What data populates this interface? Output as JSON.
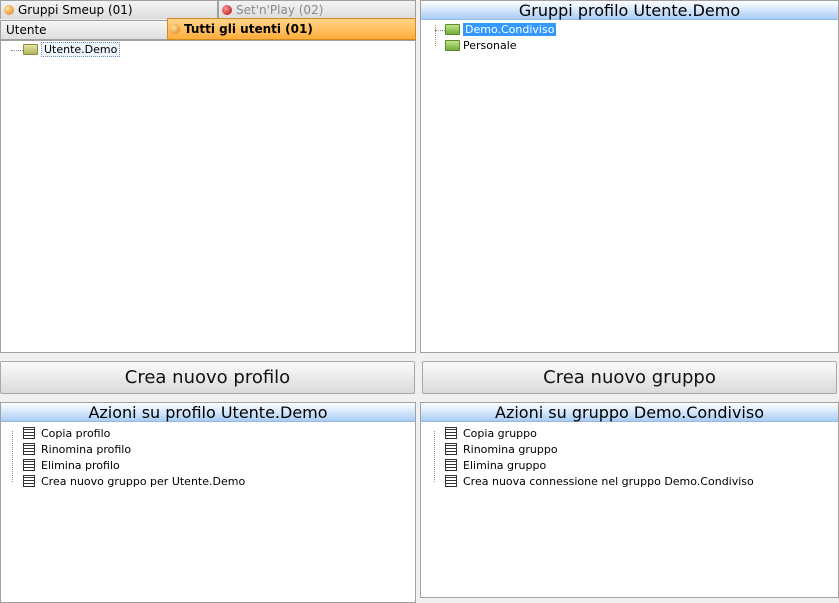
{
  "tabs": {
    "gruppi_smeup": "Gruppi Smeup (01)",
    "setnplay": "Set'n'Play (02)",
    "utente": "Utente",
    "tutti_utenti": "Tutti gli utenti (01)"
  },
  "user_tree": {
    "items": [
      "Utente.Demo"
    ]
  },
  "groups_panel": {
    "title": "Gruppi profilo Utente.Demo",
    "items": [
      "Demo.Condiviso",
      "Personale"
    ]
  },
  "buttons": {
    "new_profile": "Crea nuovo profilo",
    "new_group": "Crea nuovo gruppo"
  },
  "profile_actions": {
    "title": "Azioni su profilo Utente.Demo",
    "items": [
      "Copia profilo",
      "Rinomina profilo",
      "Elimina profilo",
      "Crea nuovo gruppo per Utente.Demo"
    ]
  },
  "group_actions": {
    "title": "Azioni su gruppo Demo.Condiviso",
    "items": [
      "Copia gruppo",
      "Rinomina gruppo",
      "Elimina gruppo",
      "Crea nuova connessione nel gruppo Demo.Condiviso"
    ]
  },
  "colors": {
    "active_tab": "#ffad3a",
    "header_blue": "#a9cdf7",
    "selection": "#3399ff"
  }
}
